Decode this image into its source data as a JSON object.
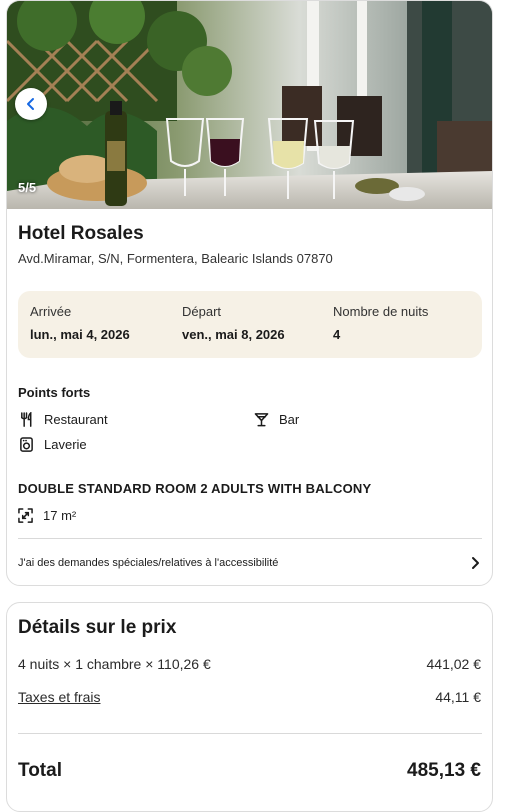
{
  "photo": {
    "counter": "5/5"
  },
  "hotel": {
    "name": "Hotel Rosales",
    "address": "Avd.Miramar, S/N, Formentera, Balearic Islands 07870"
  },
  "stay": {
    "checkin_label": "Arrivée",
    "checkin_value": "lun., mai 4, 2026",
    "checkout_label": "Départ",
    "checkout_value": "ven., mai 8, 2026",
    "nights_label": "Nombre de nuits",
    "nights_value": "4"
  },
  "highlights": {
    "title": "Points forts",
    "items": [
      {
        "label": "Restaurant",
        "icon": "restaurant-icon"
      },
      {
        "label": "Bar",
        "icon": "bar-icon"
      },
      {
        "label": "Laverie",
        "icon": "laundry-icon"
      }
    ]
  },
  "room": {
    "name": "DOUBLE STANDARD ROOM 2 ADULTS WITH BALCONY",
    "size": "17 m²",
    "size_icon": "room-size-icon"
  },
  "special_requests": {
    "label": "J'ai des demandes spéciales/relatives à l'accessibilité",
    "icon": "chevron-right-icon"
  },
  "price": {
    "title": "Détails sur le prix",
    "nightly_label": "4 nuits × 1 chambre × 110,26 €",
    "nightly_value": "441,02 €",
    "taxes_label": "Taxes et frais",
    "taxes_value": "44,11 €",
    "total_label": "Total",
    "total_value": "485,13 €"
  }
}
